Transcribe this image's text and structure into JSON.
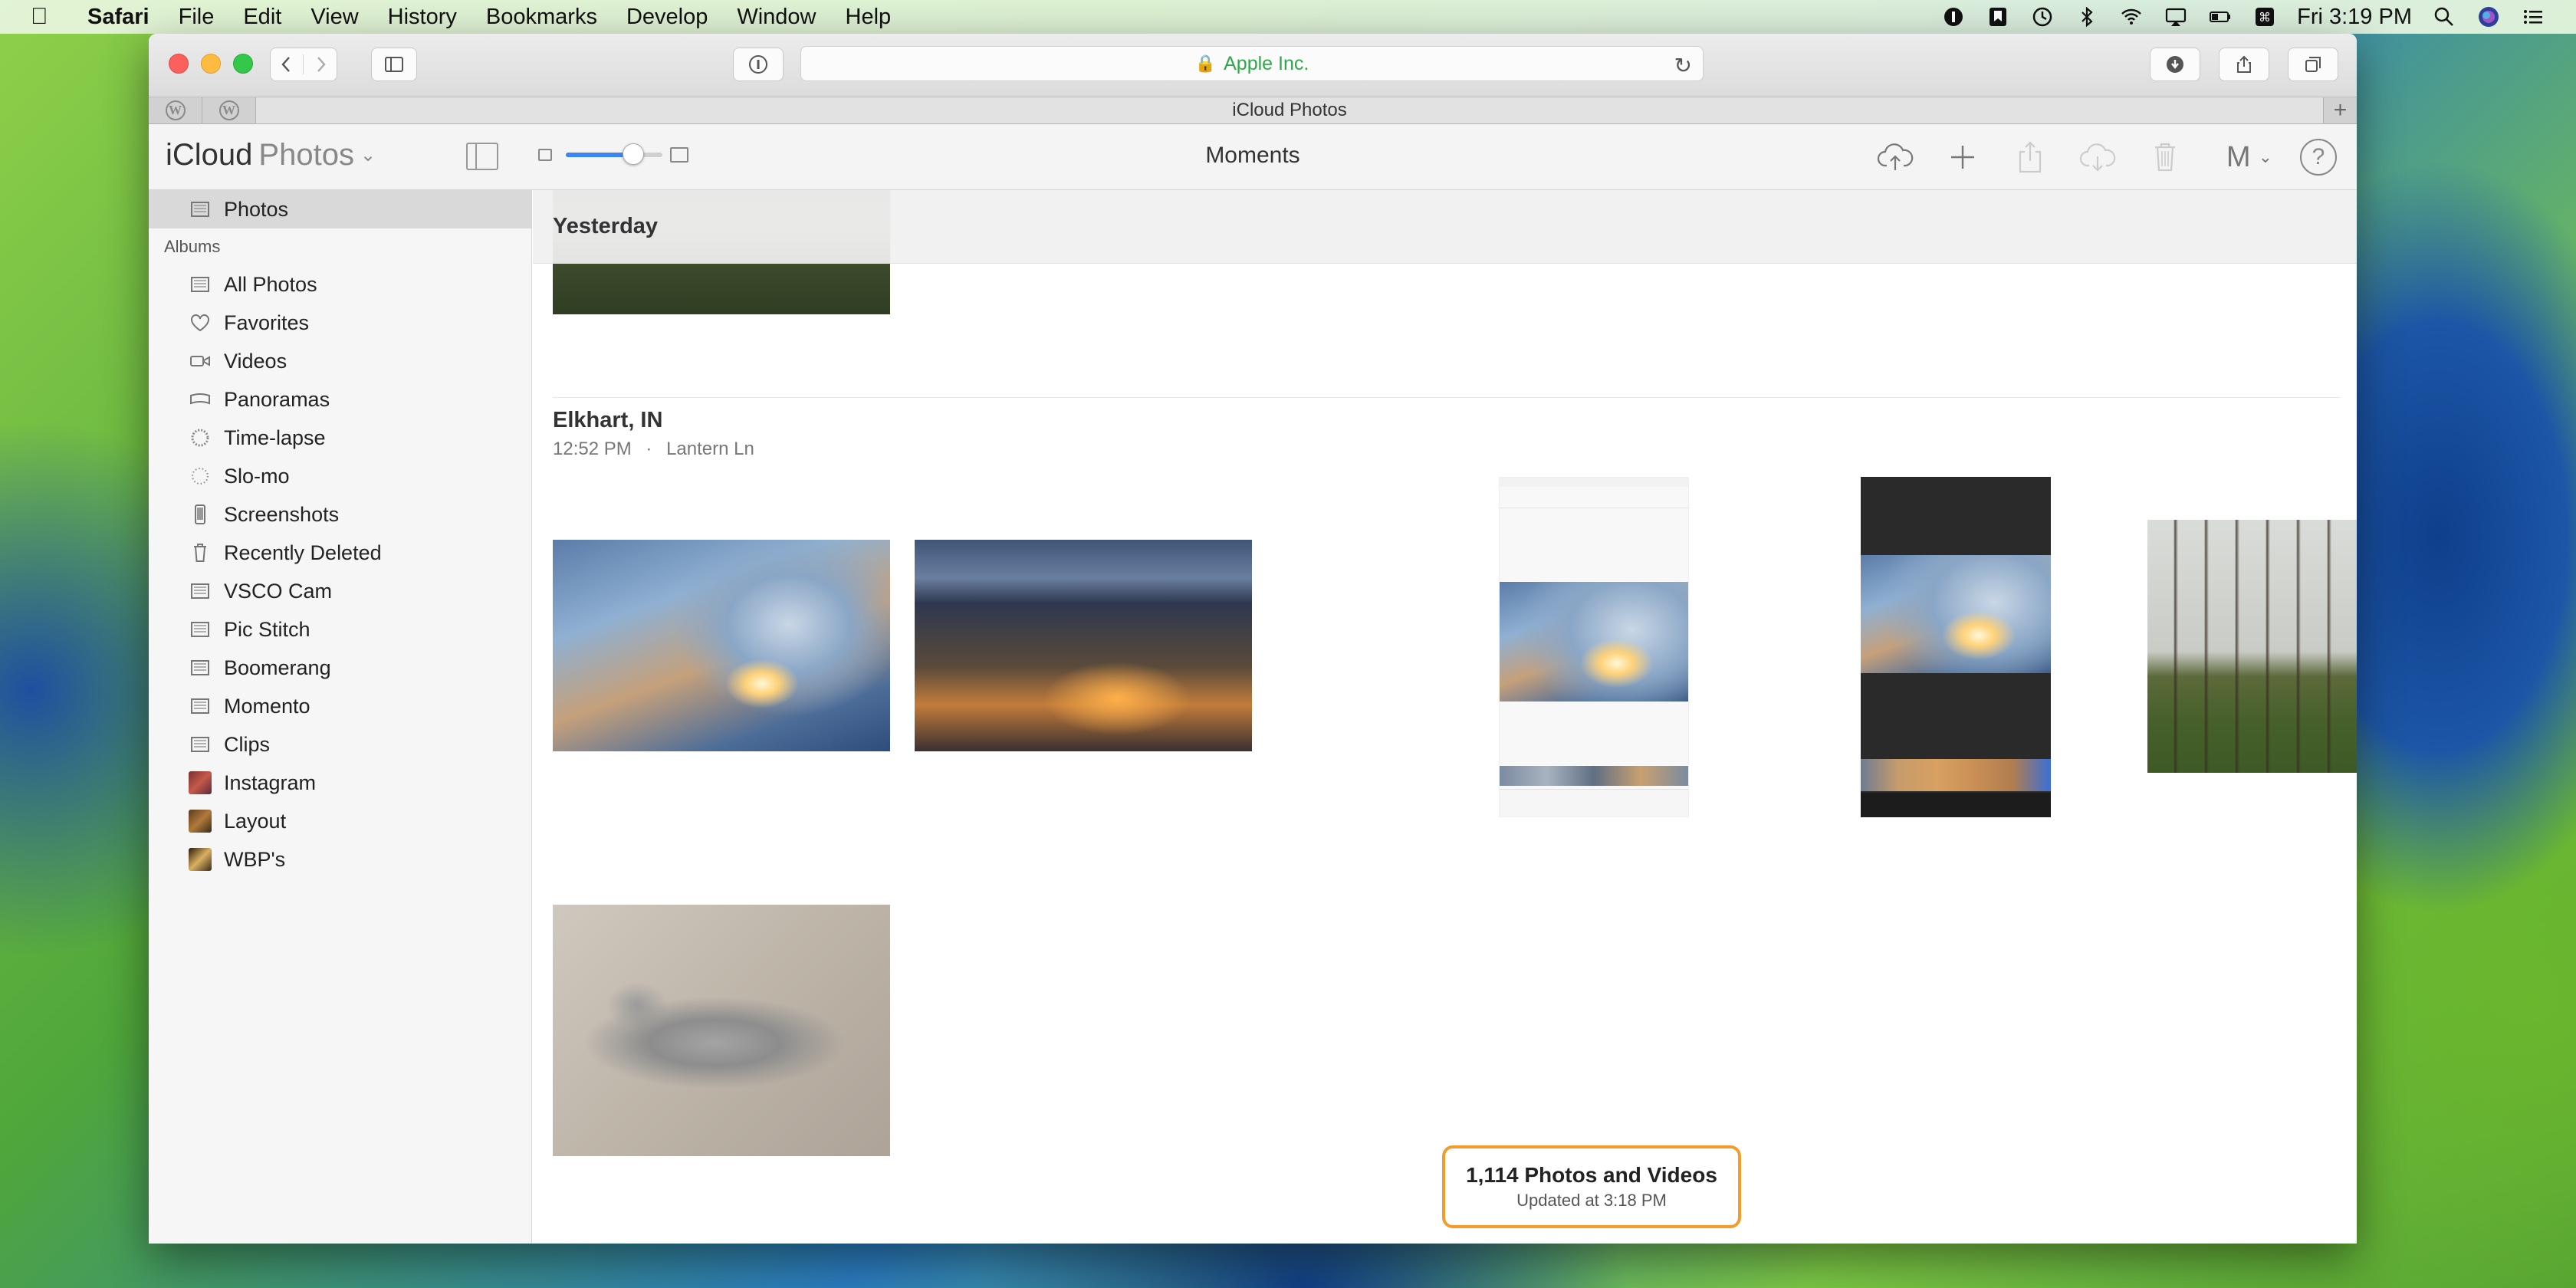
{
  "menubar": {
    "app_name": "Safari",
    "items": [
      "File",
      "Edit",
      "View",
      "History",
      "Bookmarks",
      "Develop",
      "Window",
      "Help"
    ],
    "clock": "Fri 3:19 PM"
  },
  "browser": {
    "address_text": "Apple Inc.",
    "tab_title": "iCloud Photos"
  },
  "app": {
    "brand": "iCloud",
    "brand_light": "Photos",
    "view_title": "Moments",
    "user_initial": "M",
    "zoom_level": 0.7
  },
  "sidebar": {
    "top_item": "Photos",
    "albums_heading": "Albums",
    "albums": [
      {
        "label": "All Photos",
        "icon": "album-icon"
      },
      {
        "label": "Favorites",
        "icon": "heart-icon"
      },
      {
        "label": "Videos",
        "icon": "video-icon"
      },
      {
        "label": "Panoramas",
        "icon": "panorama-icon"
      },
      {
        "label": "Time-lapse",
        "icon": "timelapse-icon"
      },
      {
        "label": "Slo-mo",
        "icon": "slomo-icon"
      },
      {
        "label": "Screenshots",
        "icon": "phone-icon"
      },
      {
        "label": "Recently Deleted",
        "icon": "trash-icon"
      },
      {
        "label": "VSCO Cam",
        "icon": "album-icon"
      },
      {
        "label": "Pic Stitch",
        "icon": "album-icon"
      },
      {
        "label": "Boomerang",
        "icon": "album-icon"
      },
      {
        "label": "Momento",
        "icon": "album-icon"
      },
      {
        "label": "Clips",
        "icon": "album-icon"
      },
      {
        "label": "Instagram",
        "icon": "thumbnail"
      },
      {
        "label": "Layout",
        "icon": "thumbnail"
      },
      {
        "label": "WBP's",
        "icon": "thumbnail"
      }
    ]
  },
  "content": {
    "section_header": "Yesterday",
    "moment": {
      "title": "Elkhart, IN",
      "time": "12:52 PM",
      "separator": "·",
      "place": "Lantern Ln"
    },
    "summary": {
      "count": "1,114 Photos and Videos",
      "updated": "Updated at 3:18 PM"
    }
  },
  "colors": {
    "accent": "#3b86f0",
    "summary_border": "#f39c2a",
    "address_green": "#2ea84a"
  }
}
